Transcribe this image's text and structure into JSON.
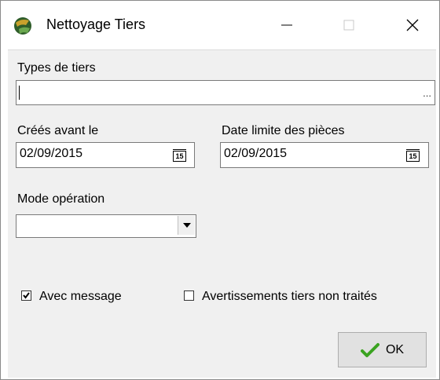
{
  "window": {
    "title": "Nettoyage Tiers",
    "minimize_icon": "minimize-icon",
    "maximize_icon": "maximize-icon",
    "close_icon": "close-icon"
  },
  "form": {
    "types_de_tiers": {
      "label": "Types de tiers",
      "value": "",
      "browse_label": "..."
    },
    "crees_avant": {
      "label": "Créés avant le",
      "value": "02/09/2015",
      "calendar_label": "15"
    },
    "date_limite": {
      "label": "Date limite des pièces",
      "value": "02/09/2015",
      "calendar_label": "15"
    },
    "mode_operation": {
      "label": "Mode opération",
      "value": ""
    },
    "avec_message": {
      "label": "Avec message",
      "checked": true
    },
    "avertissements": {
      "label": "Avertissements tiers non traités",
      "checked": false
    }
  },
  "buttons": {
    "ok_label": "OK"
  },
  "colors": {
    "accent_check": "#3aa320",
    "dialog_bg": "#f0f0f0"
  }
}
